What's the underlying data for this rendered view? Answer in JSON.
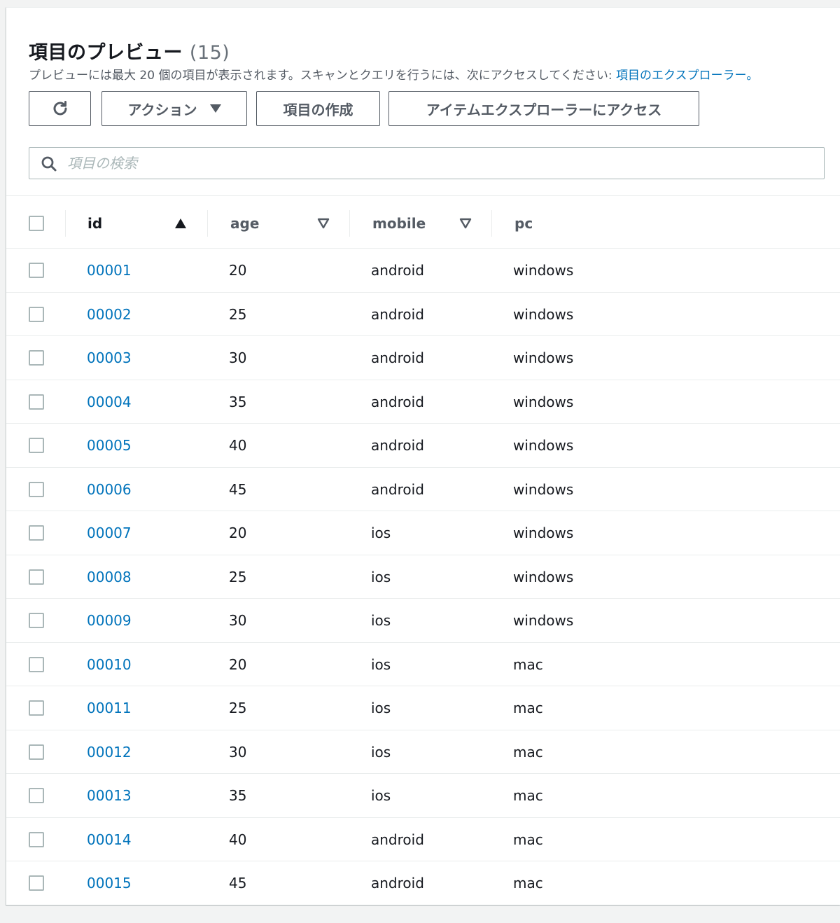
{
  "header": {
    "title": "項目のプレビュー",
    "count": "(15)",
    "description": "プレビューには最大 20 個の項目が表示されます。スキャンとクエリを行うには、次にアクセスしてください: ",
    "description_link": "項目のエクスプローラー。"
  },
  "toolbar": {
    "refresh_icon": "refresh-icon",
    "actions_label": "アクション",
    "create_label": "項目の作成",
    "explorer_label": "アイテムエクスプローラーにアクセス"
  },
  "search": {
    "placeholder": "項目の検索",
    "value": ""
  },
  "table": {
    "columns": [
      {
        "label": "id",
        "sort": "ascending"
      },
      {
        "label": "age",
        "sort": "sortable"
      },
      {
        "label": "mobile",
        "sort": "sortable"
      },
      {
        "label": "pc",
        "sort": "none"
      }
    ],
    "rows": [
      {
        "id": "00001",
        "age": "20",
        "mobile": "android",
        "pc": "windows"
      },
      {
        "id": "00002",
        "age": "25",
        "mobile": "android",
        "pc": "windows"
      },
      {
        "id": "00003",
        "age": "30",
        "mobile": "android",
        "pc": "windows"
      },
      {
        "id": "00004",
        "age": "35",
        "mobile": "android",
        "pc": "windows"
      },
      {
        "id": "00005",
        "age": "40",
        "mobile": "android",
        "pc": "windows"
      },
      {
        "id": "00006",
        "age": "45",
        "mobile": "android",
        "pc": "windows"
      },
      {
        "id": "00007",
        "age": "20",
        "mobile": "ios",
        "pc": "windows"
      },
      {
        "id": "00008",
        "age": "25",
        "mobile": "ios",
        "pc": "windows"
      },
      {
        "id": "00009",
        "age": "30",
        "mobile": "ios",
        "pc": "windows"
      },
      {
        "id": "00010",
        "age": "20",
        "mobile": "ios",
        "pc": "mac"
      },
      {
        "id": "00011",
        "age": "25",
        "mobile": "ios",
        "pc": "mac"
      },
      {
        "id": "00012",
        "age": "30",
        "mobile": "ios",
        "pc": "mac"
      },
      {
        "id": "00013",
        "age": "35",
        "mobile": "ios",
        "pc": "mac"
      },
      {
        "id": "00014",
        "age": "40",
        "mobile": "android",
        "pc": "mac"
      },
      {
        "id": "00015",
        "age": "45",
        "mobile": "android",
        "pc": "mac"
      }
    ]
  },
  "colors": {
    "link": "#0073bb",
    "text": "#16191f",
    "muted": "#545b64",
    "border": "#eaeded"
  }
}
